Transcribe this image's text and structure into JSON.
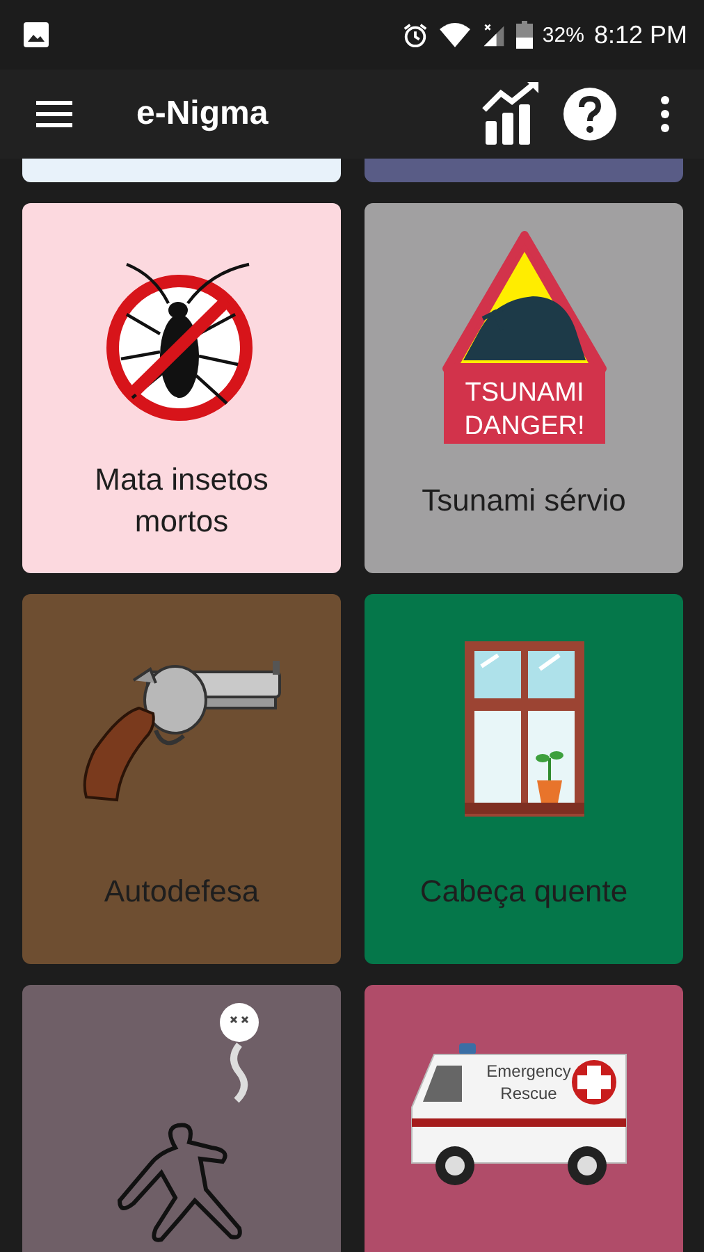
{
  "status_bar": {
    "battery": "32%",
    "time": "8:12 PM"
  },
  "app_bar": {
    "title": "e-Nigma"
  },
  "partial_cards": [
    {
      "color": "#e8f2fa"
    },
    {
      "color": "#595c86"
    }
  ],
  "cards": [
    {
      "kind": "bug",
      "label": "Mata insetos mortos",
      "color": "#fcd9df"
    },
    {
      "kind": "tsunami",
      "label": "Tsunami sérvio",
      "color": "#a1a0a1"
    },
    {
      "kind": "gun",
      "label": "Autodefesa",
      "color": "#6e4e31"
    },
    {
      "kind": "window",
      "label": "Cabeça quente",
      "color": "#05774a"
    },
    {
      "kind": "body",
      "color": "#6f5f67"
    },
    {
      "kind": "ambulance",
      "color": "#b04c69"
    }
  ],
  "tsunami_sign": {
    "lines": [
      "TSUNAMI",
      "DANGER!"
    ]
  },
  "ambulance_sign": {
    "lines": [
      "Emergency",
      "Rescue"
    ]
  }
}
